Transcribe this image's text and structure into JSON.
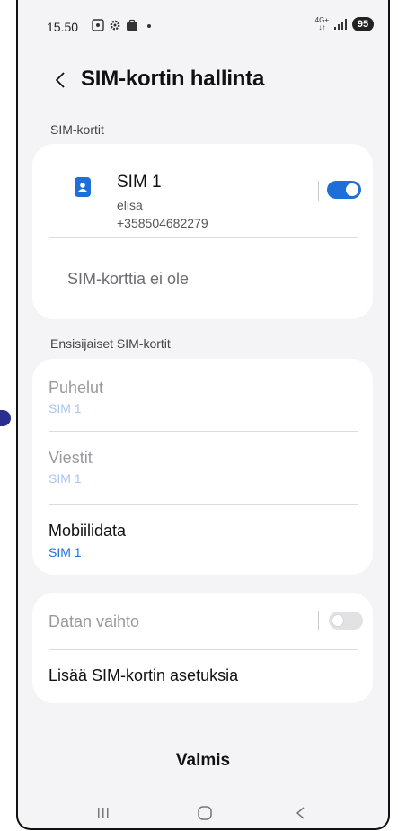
{
  "status_bar": {
    "time": "15.50",
    "network_top": "4G+",
    "network_bottom": "↓↑",
    "battery": "95"
  },
  "header": {
    "title": "SIM-kortin hallinta"
  },
  "sim_section": {
    "label": "SIM-kortit",
    "sim1": {
      "name": "SIM 1",
      "operator": "elisa",
      "number": "+358504682279",
      "enabled": true
    },
    "empty_slot": "SIM-korttia ei ole"
  },
  "preferred_section": {
    "label": "Ensisijaiset SIM-kortit",
    "items": [
      {
        "title": "Puhelut",
        "value": "SIM 1"
      },
      {
        "title": "Viestit",
        "value": "SIM 1"
      },
      {
        "title": "Mobiilidata",
        "value": "SIM 1"
      }
    ]
  },
  "more_section": {
    "data_switch": {
      "label": "Datan vaihto",
      "enabled": false
    },
    "more_settings": "Lisää SIM-kortin asetuksia"
  },
  "done_button": "Valmis",
  "colors": {
    "accent": "#1f6fd9",
    "background": "#f4f4f6",
    "card": "#ffffff"
  }
}
